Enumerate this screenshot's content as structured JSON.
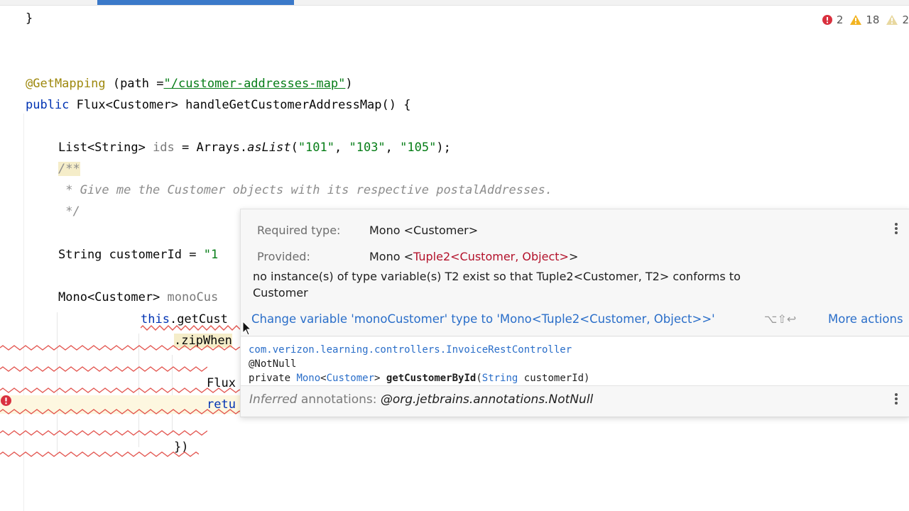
{
  "inspections": {
    "errors": "2",
    "warnings": "18",
    "weak_warnings": "2"
  },
  "code": {
    "l1": "}",
    "mapping_annotation": "@GetMapping",
    "mapping_open": " (path =",
    "mapping_path": "\"/customer-addresses-map\"",
    "mapping_close": ")",
    "kw_public": "public",
    "method_sig": " Flux<Customer> handleGetCustomerAddressMap() {",
    "list_type": "List<String> ",
    "list_var": "ids",
    "list_eq": " = Arrays.",
    "list_method": "asList",
    "list_open": "(",
    "str_101": "\"101\"",
    "comma1": ", ",
    "str_103": "\"103\"",
    "comma2": ", ",
    "str_105": "\"105\"",
    "list_end": ");",
    "doc_open": "/**",
    "doc_body": " * Give me the Customer objects with its respective postalAddresses.",
    "doc_close": " */",
    "cust_decl": "String customerId = ",
    "cust_str": "\"1",
    "mono_type": "Mono<Customer> ",
    "mono_var": "monoCus",
    "this_kw": "this",
    "get_cust": ".getCust",
    "zip_when": ".zipWhen",
    "flux": "Flux",
    "retu": "retu",
    "close_brace": "})"
  },
  "popup": {
    "required_label": "Required type:",
    "required_value": "Mono <Customer>",
    "provided_label": "Provided:",
    "provided_prefix": "Mono <",
    "provided_red": "Tuple2<Customer, Object>",
    "provided_suffix": ">",
    "message_line1": "no instance(s) of type variable(s) T2 exist so that Tuple2<Customer, T2> conforms to",
    "message_line2": "Customer",
    "fix_action": "Change variable 'monoCustomer' type to 'Mono<Tuple2<Customer, Object>>'",
    "fix_shortcut": "⌥⇧↩",
    "more_actions": "More actions",
    "doc_class": "com.verizon.learning.controllers.InvoiceRestController",
    "doc_annotation": "@NotNull",
    "doc_private": "private ",
    "doc_mono": "Mono",
    "doc_lt": "<",
    "doc_customer": "Customer",
    "doc_gt": "> ",
    "doc_method": "getCustomerById",
    "doc_paren": "(",
    "doc_string": "String",
    "doc_param": " customerId)",
    "inferred_label": "Inferred",
    "inferred_text": " annotations: ",
    "inferred_value": "@org.jetbrains.annotations.NotNull"
  }
}
